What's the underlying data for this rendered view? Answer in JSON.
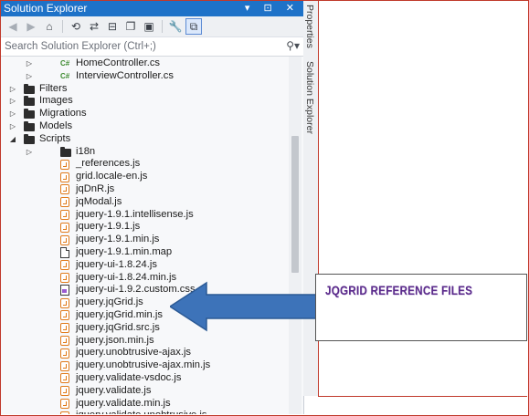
{
  "panel": {
    "title": "Solution Explorer",
    "title_controls": "▾ ⊡ ✕",
    "search_placeholder": "Search Solution Explorer (Ctrl+;)",
    "search_icon": "search-icon",
    "side_tabs": [
      "Properties",
      "Solution Explorer"
    ]
  },
  "toolbar": {
    "buttons": [
      "back-icon",
      "forward-icon",
      "home-icon",
      "history-icon",
      "sync-icon",
      "collapse-icon",
      "copy-icon",
      "show-all-icon",
      "properties-icon",
      "preview-icon"
    ]
  },
  "tree": [
    {
      "label": "HomeController.cs",
      "type": "cs",
      "level": 2,
      "expander": "collapsed"
    },
    {
      "label": "InterviewController.cs",
      "type": "cs",
      "level": 2,
      "expander": "collapsed"
    },
    {
      "label": "Filters",
      "type": "folder",
      "level": 1,
      "expander": "collapsed"
    },
    {
      "label": "Images",
      "type": "folder",
      "level": 1,
      "expander": "collapsed"
    },
    {
      "label": "Migrations",
      "type": "folder",
      "level": 1,
      "expander": "collapsed"
    },
    {
      "label": "Models",
      "type": "folder",
      "level": 1,
      "expander": "collapsed"
    },
    {
      "label": "Scripts",
      "type": "folder",
      "level": 1,
      "expander": "expanded"
    },
    {
      "label": "i18n",
      "type": "folder",
      "level": 2,
      "expander": "collapsed"
    },
    {
      "label": "_references.js",
      "type": "js",
      "level": 2,
      "expander": "none"
    },
    {
      "label": "grid.locale-en.js",
      "type": "js",
      "level": 2,
      "expander": "none"
    },
    {
      "label": "jqDnR.js",
      "type": "js",
      "level": 2,
      "expander": "none"
    },
    {
      "label": "jqModal.js",
      "type": "js",
      "level": 2,
      "expander": "none"
    },
    {
      "label": "jquery-1.9.1.intellisense.js",
      "type": "js",
      "level": 2,
      "expander": "none"
    },
    {
      "label": "jquery-1.9.1.js",
      "type": "js",
      "level": 2,
      "expander": "none"
    },
    {
      "label": "jquery-1.9.1.min.js",
      "type": "js",
      "level": 2,
      "expander": "none"
    },
    {
      "label": "jquery-1.9.1.min.map",
      "type": "doc",
      "level": 2,
      "expander": "none"
    },
    {
      "label": "jquery-ui-1.8.24.js",
      "type": "js",
      "level": 2,
      "expander": "none"
    },
    {
      "label": "jquery-ui-1.8.24.min.js",
      "type": "js",
      "level": 2,
      "expander": "none"
    },
    {
      "label": "jquery-ui-1.9.2.custom.css",
      "type": "css",
      "level": 2,
      "expander": "none"
    },
    {
      "label": "jquery.jqGrid.js",
      "type": "js",
      "level": 2,
      "expander": "none"
    },
    {
      "label": "jquery.jqGrid.min.js",
      "type": "js",
      "level": 2,
      "expander": "none"
    },
    {
      "label": "jquery.jqGrid.src.js",
      "type": "js",
      "level": 2,
      "expander": "none"
    },
    {
      "label": "jquery.json.min.js",
      "type": "js",
      "level": 2,
      "expander": "none"
    },
    {
      "label": "jquery.unobtrusive-ajax.js",
      "type": "js",
      "level": 2,
      "expander": "none"
    },
    {
      "label": "jquery.unobtrusive-ajax.min.js",
      "type": "js",
      "level": 2,
      "expander": "none"
    },
    {
      "label": "jquery.validate-vsdoc.js",
      "type": "js",
      "level": 2,
      "expander": "none"
    },
    {
      "label": "jquery.validate.js",
      "type": "js",
      "level": 2,
      "expander": "none"
    },
    {
      "label": "jquery.validate.min.js",
      "type": "js",
      "level": 2,
      "expander": "none"
    },
    {
      "label": "jquery.validate.unobtrusive.js",
      "type": "js",
      "level": 2,
      "expander": "none"
    }
  ],
  "callout": {
    "text": "JQGRID REFERENCE FILES",
    "text_color": "#5a2a8a",
    "arrow_color": "#3d73b9"
  },
  "colors": {
    "titlebar": "#1e72c8",
    "frame_border": "#c0392b"
  }
}
